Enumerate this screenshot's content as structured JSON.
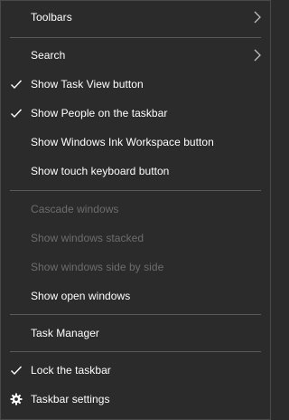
{
  "menu": {
    "items": [
      {
        "label": "Toolbars",
        "submenu": true
      },
      {
        "label": "Search",
        "submenu": true
      },
      {
        "label": "Show Task View button",
        "checked": true
      },
      {
        "label": "Show People on the taskbar",
        "checked": true
      },
      {
        "label": "Show Windows Ink Workspace button"
      },
      {
        "label": "Show touch keyboard button"
      },
      {
        "label": "Cascade windows",
        "disabled": true
      },
      {
        "label": "Show windows stacked",
        "disabled": true
      },
      {
        "label": "Show windows side by side",
        "disabled": true
      },
      {
        "label": "Show open windows"
      },
      {
        "label": "Task Manager"
      },
      {
        "label": "Lock the taskbar",
        "checked": true
      },
      {
        "label": "Taskbar settings",
        "icon": "gear-icon"
      }
    ]
  },
  "colors": {
    "background": "#2b2b2b",
    "text": "#ffffff",
    "disabled_text": "#6d6d6d",
    "separator": "#5a5a5a"
  }
}
